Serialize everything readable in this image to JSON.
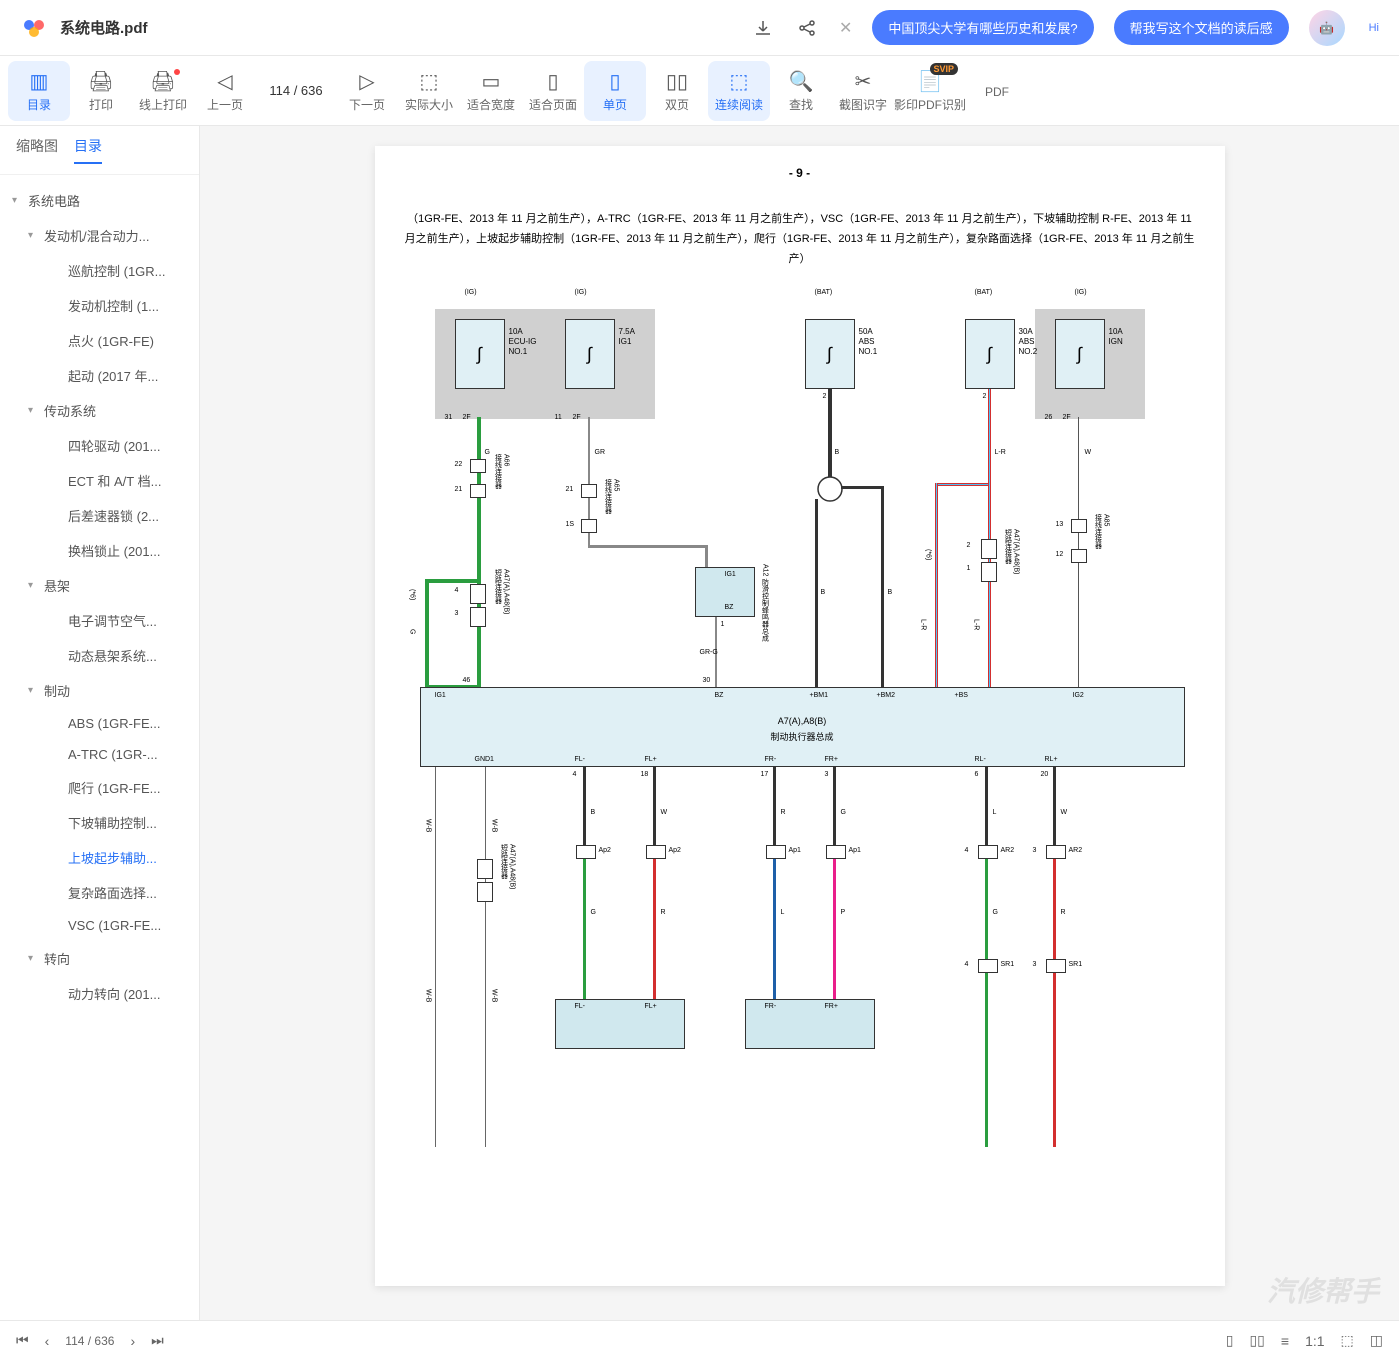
{
  "file": {
    "name": "系统电路.pdf"
  },
  "header": {
    "prompt1": "中国顶尖大学有哪些历史和发展?",
    "prompt2": "帮我写这个文档的读后感",
    "hi": "Hi"
  },
  "toolbar": {
    "catalog": "目录",
    "print": "打印",
    "onlinePrint": "线上打印",
    "prevPage": "上一页",
    "pageIndicator": "114 / 636",
    "nextPage": "下一页",
    "actualSize": "实际大小",
    "fitWidth": "适合宽度",
    "fitPage": "适合页面",
    "singlePage": "单页",
    "doublePage": "双页",
    "continuous": "连续阅读",
    "search": "查找",
    "screenshot": "截图识字",
    "ocr": "影印PDF识别",
    "pdf": "PDF"
  },
  "sidebar": {
    "tabs": {
      "thumbnail": "缩略图",
      "outline": "目录"
    },
    "tree": [
      {
        "label": "系统电路",
        "indent": 0,
        "caret": "▾"
      },
      {
        "label": "发动机/混合动力...",
        "indent": 1,
        "caret": "▾"
      },
      {
        "label": "巡航控制 (1GR...",
        "indent": 2
      },
      {
        "label": "发动机控制 (1...",
        "indent": 2
      },
      {
        "label": "点火 (1GR-FE)",
        "indent": 2
      },
      {
        "label": "起动 (2017 年...",
        "indent": 2
      },
      {
        "label": "传动系统",
        "indent": 1,
        "caret": "▾"
      },
      {
        "label": "四轮驱动 (201...",
        "indent": 2
      },
      {
        "label": "ECT 和 A/T 档...",
        "indent": 2
      },
      {
        "label": "后差速器锁 (2...",
        "indent": 2
      },
      {
        "label": "换档锁止 (201...",
        "indent": 2
      },
      {
        "label": "悬架",
        "indent": 1,
        "caret": "▾"
      },
      {
        "label": "电子调节空气...",
        "indent": 2
      },
      {
        "label": "动态悬架系统...",
        "indent": 2
      },
      {
        "label": "制动",
        "indent": 1,
        "caret": "▾"
      },
      {
        "label": "ABS (1GR-FE...",
        "indent": 2
      },
      {
        "label": "A-TRC (1GR-...",
        "indent": 2
      },
      {
        "label": "爬行 (1GR-FE...",
        "indent": 2
      },
      {
        "label": "下坡辅助控制...",
        "indent": 2
      },
      {
        "label": "上坡起步辅助...",
        "indent": 2,
        "selected": true
      },
      {
        "label": "复杂路面选择...",
        "indent": 2
      },
      {
        "label": "VSC (1GR-FE...",
        "indent": 2
      },
      {
        "label": "转向",
        "indent": 1,
        "caret": "▾"
      },
      {
        "label": "动力转向 (201...",
        "indent": 2
      }
    ]
  },
  "document": {
    "pageNumber": "- 9 -",
    "title": "（1GR-FE、2013 年 11 月之前生产），A-TRC（1GR-FE、2013 年 11 月之前生产），VSC（1GR-FE、2013 年 11 月之前生产），下坡辅助控制 R-FE、2013 年 11 月之前生产），上坡起步辅助控制（1GR-FE、2013 年 11 月之前生产），爬行（1GR-FE、2013 年 11 月之前生产），复杂路面选择（1GR-FE、2013 年 11 月之前生产）",
    "sourceLabels": {
      "ig": "(IG)",
      "bat": "(BAT)"
    },
    "fuses": {
      "f1": "10A\nECU-IG\nNO.1",
      "f2": "7.5A\nIG1",
      "f3": "50A\nABS\nNO.1",
      "f4": "30A\nABS\nNO.2",
      "f5": "10A\nIGN"
    },
    "ecuMain": {
      "id": "A7(A),A8(B)",
      "name": "制动执行器总成"
    },
    "connA12": {
      "id": "A12",
      "name": "防滑控制蜂鸣器总成",
      "sig": "IG1",
      "pin": "BZ"
    },
    "connectors": {
      "a66": "A66\n接线连接器",
      "a65": "A65\n接线连接器",
      "a47": "A47(A),A48(B)\n短路连接器",
      "a47b": "A47(A),A48(B)\n短路连接器",
      "a85": "A85\n接线连接器"
    },
    "signals": {
      "top": {
        "p31": "31",
        "p11": "11",
        "p1a": "1",
        "p1b": "1",
        "p26": "26",
        "pf2f": "2F"
      },
      "ecuTop": {
        "ig1": "IG1",
        "bz": "BZ",
        "bm1": "+BM1",
        "bm2": "+BM2",
        "bs": "+BS",
        "ig2": "IG2",
        "p46": "46",
        "p30": "30"
      },
      "ecuBot": {
        "gnd1": "GND1",
        "flm": "FL-",
        "flp": "FL+",
        "frm": "FR-",
        "frp": "FR+",
        "rlm": "RL-",
        "rlp": "RL+",
        "p4": "4",
        "p18": "18",
        "p17": "17",
        "p3": "3",
        "p6": "6",
        "p20": "20"
      },
      "wireColors": {
        "g": "G",
        "gr": "GR",
        "grg": "GR-G",
        "b": "B",
        "lr": "L-R",
        "w": "W",
        "r": "R",
        "l": "L",
        "p": "P",
        "wb": "W-B"
      },
      "ap": {
        "ap2": "Ap2",
        "ap1": "Ap1",
        "ar2": "AR2",
        "sr1": "SR1"
      },
      "nums": {
        "n22": "22",
        "n21": "21",
        "n1s": "1S",
        "n13": "13",
        "n12": "12",
        "n2": "2",
        "n4": "4",
        "n3": "3",
        "n1": "1"
      },
      "side": "(*6)"
    },
    "bottomBoxes": {
      "fl": "FL-",
      "flp": "FL+",
      "fr": "FR-",
      "frp": "FR+"
    }
  },
  "bottomBar": {
    "pageText": "114 / 636"
  },
  "watermark": "汽修帮手"
}
